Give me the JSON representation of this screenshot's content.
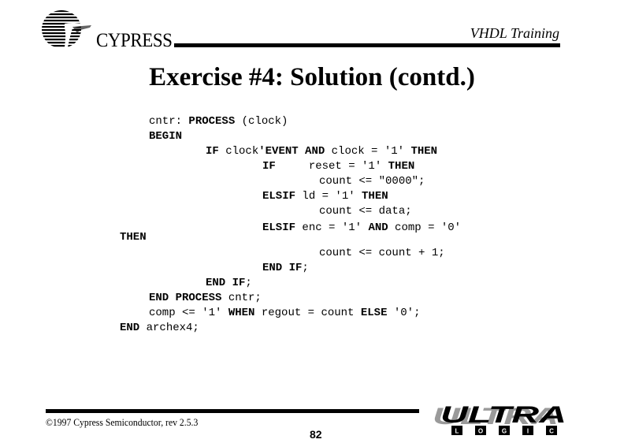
{
  "header": {
    "logo_text": "CYPRESS",
    "course_title": "VHDL Training"
  },
  "slide": {
    "title": "Exercise #4: Solution (contd.)"
  },
  "code": {
    "lines": [
      [
        {
          "t": "cntr: ",
          "k": false
        },
        {
          "t": "PROCESS",
          "k": true
        },
        {
          "t": " (clock)",
          "k": false
        }
      ],
      [
        {
          "t": "BEGIN",
          "k": true
        }
      ],
      [
        {
          "t": "IF",
          "k": true
        },
        {
          "t": " clock",
          "k": false
        },
        {
          "t": "'EVENT AND",
          "k": true
        },
        {
          "t": " clock = '1' ",
          "k": false
        },
        {
          "t": "THEN",
          "k": true
        }
      ],
      [
        {
          "t": "IF",
          "k": true
        },
        {
          "t": "     reset = '1' ",
          "k": false
        },
        {
          "t": "THEN",
          "k": true
        }
      ],
      [
        {
          "t": "count <= \"0000\";",
          "k": false
        }
      ],
      [
        {
          "t": "ELSIF",
          "k": true
        },
        {
          "t": " ld = '1' ",
          "k": false
        },
        {
          "t": "THEN",
          "k": true
        }
      ],
      [
        {
          "t": "count <= data;",
          "k": false
        }
      ],
      [
        {
          "t": "ELSIF",
          "k": true
        },
        {
          "t": " enc = '1' ",
          "k": false
        },
        {
          "t": "AND",
          "k": true
        },
        {
          "t": " comp = '0'",
          "k": false
        }
      ],
      [
        {
          "t": "THEN",
          "k": true
        }
      ],
      [
        {
          "t": "count <= count + 1;",
          "k": false
        }
      ],
      [
        {
          "t": "END IF",
          "k": true
        },
        {
          "t": ";",
          "k": false
        }
      ],
      [
        {
          "t": "END IF",
          "k": true
        },
        {
          "t": ";",
          "k": false
        }
      ],
      [
        {
          "t": "END PROCESS",
          "k": true
        },
        {
          "t": " cntr;",
          "k": false
        }
      ],
      [
        {
          "t": "comp <= '1' ",
          "k": false
        },
        {
          "t": "WHEN",
          "k": true
        },
        {
          "t": " regout = count ",
          "k": false
        },
        {
          "t": "ELSE",
          "k": true
        },
        {
          "t": " '0';",
          "k": false
        }
      ],
      [
        {
          "t": "END",
          "k": true
        },
        {
          "t": " archex4;",
          "k": false
        }
      ]
    ]
  },
  "footer": {
    "copyright": "©1997 Cypress Semiconductor, rev 2.5.3",
    "page_number": "82",
    "brand_logo_top": "ULTRA",
    "brand_logo_bottom": [
      "L",
      "O",
      "G",
      "I",
      "C"
    ]
  }
}
